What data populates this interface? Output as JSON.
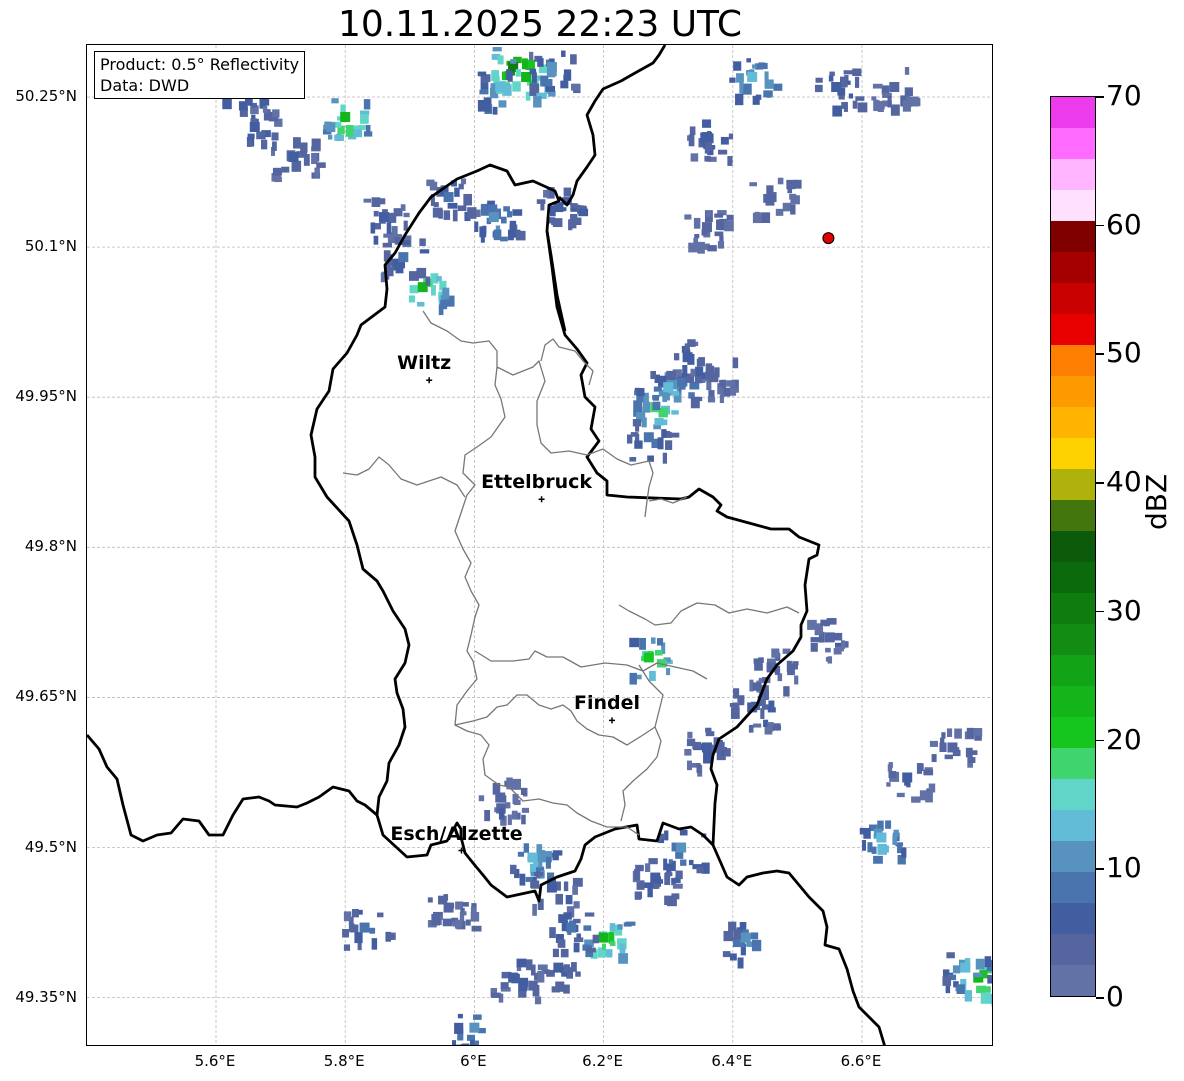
{
  "title": "10.11.2025 22:23 UTC",
  "info": {
    "product": "Product: 0.5° Reflectivity",
    "source": "Data: DWD"
  },
  "map": {
    "lon_range": [
      5.4,
      6.8
    ],
    "lat_range": [
      49.3,
      50.3
    ],
    "lat_ticks": [
      {
        "value": 50.25,
        "label": "50.25°N"
      },
      {
        "value": 50.1,
        "label": "50.1°N"
      },
      {
        "value": 49.95,
        "label": "49.95°N"
      },
      {
        "value": 49.8,
        "label": "49.8°N"
      },
      {
        "value": 49.65,
        "label": "49.65°N"
      },
      {
        "value": 49.5,
        "label": "49.5°N"
      },
      {
        "value": 49.35,
        "label": "49.35°N"
      }
    ],
    "lon_ticks": [
      {
        "value": 5.6,
        "label": "5.6°E"
      },
      {
        "value": 5.8,
        "label": "5.8°E"
      },
      {
        "value": 6.0,
        "label": "6°E"
      },
      {
        "value": 6.2,
        "label": "6.2°E"
      },
      {
        "value": 6.4,
        "label": "6.4°E"
      },
      {
        "value": 6.6,
        "label": "6.6°E"
      }
    ],
    "cities": [
      {
        "name": "Wiltz",
        "lon": 5.93,
        "lat": 49.967
      },
      {
        "name": "Ettelbruck",
        "lon": 6.104,
        "lat": 49.848
      },
      {
        "name": "Findel",
        "lon": 6.213,
        "lat": 49.627
      },
      {
        "name": "Esch/Alzette",
        "lon": 5.98,
        "lat": 49.497
      }
    ],
    "radar_site": {
      "lon": 6.548,
      "lat": 50.109,
      "color": "#e00000"
    },
    "echoes": [
      {
        "lon": 5.66,
        "lat": 50.22,
        "dbz": 6
      },
      {
        "lon": 5.72,
        "lat": 50.19,
        "dbz": 5
      },
      {
        "lon": 5.64,
        "lat": 50.26,
        "dbz": 8
      },
      {
        "lon": 5.8,
        "lat": 50.23,
        "dbz": 22
      },
      {
        "lon": 6.06,
        "lat": 50.28,
        "dbz": 30
      },
      {
        "lon": 6.08,
        "lat": 50.27,
        "dbz": 24
      },
      {
        "lon": 6.04,
        "lat": 50.26,
        "dbz": 14
      },
      {
        "lon": 6.12,
        "lat": 50.28,
        "dbz": 10
      },
      {
        "lon": 6.43,
        "lat": 50.27,
        "dbz": 14
      },
      {
        "lon": 6.56,
        "lat": 50.26,
        "dbz": 7
      },
      {
        "lon": 6.65,
        "lat": 50.26,
        "dbz": 4
      },
      {
        "lon": 6.36,
        "lat": 50.21,
        "dbz": 6
      },
      {
        "lon": 6.46,
        "lat": 50.15,
        "dbz": 4
      },
      {
        "lon": 5.86,
        "lat": 50.13,
        "dbz": 6
      },
      {
        "lon": 5.96,
        "lat": 50.15,
        "dbz": 8
      },
      {
        "lon": 6.03,
        "lat": 50.13,
        "dbz": 12
      },
      {
        "lon": 5.92,
        "lat": 50.06,
        "dbz": 22
      },
      {
        "lon": 5.89,
        "lat": 50.09,
        "dbz": 8
      },
      {
        "lon": 6.13,
        "lat": 50.14,
        "dbz": 6
      },
      {
        "lon": 6.36,
        "lat": 50.12,
        "dbz": 4
      },
      {
        "lon": 6.28,
        "lat": 49.94,
        "dbz": 18
      },
      {
        "lon": 6.3,
        "lat": 49.96,
        "dbz": 14
      },
      {
        "lon": 6.27,
        "lat": 49.91,
        "dbz": 8
      },
      {
        "lon": 6.33,
        "lat": 49.99,
        "dbz": 6
      },
      {
        "lon": 6.37,
        "lat": 49.97,
        "dbz": 4
      },
      {
        "lon": 6.55,
        "lat": 49.71,
        "dbz": 4
      },
      {
        "lon": 6.43,
        "lat": 49.64,
        "dbz": 6
      },
      {
        "lon": 6.36,
        "lat": 49.6,
        "dbz": 5
      },
      {
        "lon": 6.46,
        "lat": 49.68,
        "dbz": 4
      },
      {
        "lon": 6.63,
        "lat": 49.51,
        "dbz": 14
      },
      {
        "lon": 6.67,
        "lat": 49.57,
        "dbz": 5
      },
      {
        "lon": 6.74,
        "lat": 49.6,
        "dbz": 4
      },
      {
        "lon": 6.32,
        "lat": 49.5,
        "dbz": 12
      },
      {
        "lon": 6.28,
        "lat": 49.47,
        "dbz": 6
      },
      {
        "lon": 6.09,
        "lat": 49.49,
        "dbz": 14
      },
      {
        "lon": 6.12,
        "lat": 49.46,
        "dbz": 6
      },
      {
        "lon": 6.2,
        "lat": 49.41,
        "dbz": 22
      },
      {
        "lon": 6.15,
        "lat": 49.42,
        "dbz": 8
      },
      {
        "lon": 6.42,
        "lat": 49.41,
        "dbz": 10
      },
      {
        "lon": 6.78,
        "lat": 49.37,
        "dbz": 24
      },
      {
        "lon": 6.76,
        "lat": 49.38,
        "dbz": 14
      },
      {
        "lon": 5.83,
        "lat": 49.42,
        "dbz": 8
      },
      {
        "lon": 6.0,
        "lat": 49.32,
        "dbz": 10
      },
      {
        "lon": 6.06,
        "lat": 49.37,
        "dbz": 6
      },
      {
        "lon": 6.13,
        "lat": 49.38,
        "dbz": 5
      },
      {
        "lon": 5.96,
        "lat": 49.44,
        "dbz": 4
      },
      {
        "lon": 6.04,
        "lat": 49.55,
        "dbz": 4
      },
      {
        "lon": 6.27,
        "lat": 49.69,
        "dbz": 20
      }
    ]
  },
  "colorbar": {
    "label": "dBZ",
    "min": 0,
    "max": 70,
    "ticks": [
      {
        "value": 0,
        "label": "0"
      },
      {
        "value": 10,
        "label": "10"
      },
      {
        "value": 20,
        "label": "20"
      },
      {
        "value": 30,
        "label": "30"
      },
      {
        "value": 40,
        "label": "40"
      },
      {
        "value": 50,
        "label": "50"
      },
      {
        "value": 60,
        "label": "60"
      },
      {
        "value": 70,
        "label": "70"
      }
    ],
    "colors": [
      "#6272a7",
      "#5465a0",
      "#435ea0",
      "#4a74ad",
      "#5893c0",
      "#63bcd7",
      "#61d6c8",
      "#3fd46d",
      "#14c61e",
      "#14b51b",
      "#12a316",
      "#128c12",
      "#0f7c0f",
      "#0b6a0b",
      "#0b5b0b",
      "#43760d",
      "#afb20b",
      "#fed200",
      "#feb400",
      "#fd9a00",
      "#fd7e00",
      "#e80000",
      "#c90000",
      "#a50000",
      "#800000",
      "#ffe0ff",
      "#ffb5ff",
      "#ff6aff",
      "#eb3bed"
    ]
  }
}
